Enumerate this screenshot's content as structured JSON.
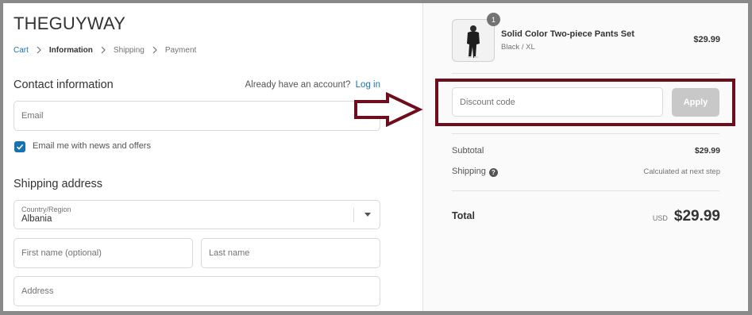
{
  "store": {
    "name": "THEGUYWAY"
  },
  "breadcrumb": [
    "Cart",
    "Information",
    "Shipping",
    "Payment"
  ],
  "contact": {
    "title": "Contact information",
    "account_prompt": "Already have an account?",
    "login_link": "Log in",
    "email_placeholder": "Email",
    "newsletter_label": "Email me with news and offers",
    "newsletter_checked": true
  },
  "shipping": {
    "title": "Shipping address",
    "country_label": "Country/Region",
    "country_value": "Albania",
    "first_name_placeholder": "First name (optional)",
    "last_name_placeholder": "Last name",
    "address_placeholder": "Address"
  },
  "order": {
    "item": {
      "quantity": "1",
      "name": "Solid Color Two-piece Pants Set",
      "variant": "Black / XL",
      "price": "$29.99"
    },
    "discount_placeholder": "Discount code",
    "apply_label": "Apply",
    "subtotal_label": "Subtotal",
    "subtotal_value": "$29.99",
    "shipping_label": "Shipping",
    "shipping_value": "Calculated at next step",
    "total_label": "Total",
    "currency": "USD",
    "total_value": "$29.99"
  },
  "colors": {
    "link": "#1773b0",
    "annotation": "#6f0d1c",
    "apply_button": "#c8c8c8"
  },
  "icons": [
    "chevron-right-icon",
    "check-icon",
    "dropdown-arrow-icon",
    "help-icon",
    "right-arrow-annotation-icon"
  ]
}
